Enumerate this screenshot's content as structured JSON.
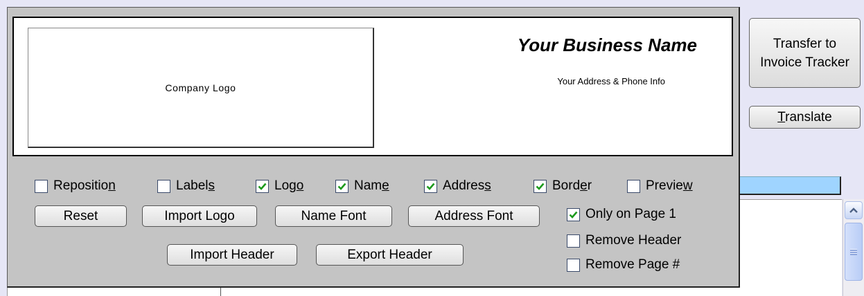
{
  "actions": {
    "transfer_label": "Transfer to Invoice Tracker",
    "translate_label": "Translate"
  },
  "preview": {
    "logo_placeholder": "Company Logo",
    "business_name": "Your Business Name",
    "address_info": "Your Address & Phone Info"
  },
  "options": {
    "reposition": {
      "label": "Reposition",
      "checked": false
    },
    "labels": {
      "label": "Labels",
      "checked": false
    },
    "logo": {
      "label": "Logo",
      "checked": true
    },
    "name": {
      "label": "Name",
      "checked": true
    },
    "address": {
      "label": "Address",
      "checked": true
    },
    "border": {
      "label": "Border",
      "checked": true
    },
    "preview": {
      "label": "Preview",
      "checked": false
    },
    "only_page1": {
      "label": "Only on Page 1",
      "checked": true
    },
    "remove_header": {
      "label": "Remove Header",
      "checked": false
    },
    "remove_page_num": {
      "label": "Remove Page #",
      "checked": false
    }
  },
  "buttons": {
    "reset": "Reset",
    "import_logo": "Import Logo",
    "name_font": "Name Font",
    "address_font": "Address Font",
    "import_header": "Import Header",
    "export_header": "Export Header"
  },
  "colors": {
    "checkmark": "#1c9a1c",
    "panel_bg": "#c4c4c4",
    "page_bg": "#e6e6f6",
    "highlight_bar": "#9fd4ff"
  }
}
